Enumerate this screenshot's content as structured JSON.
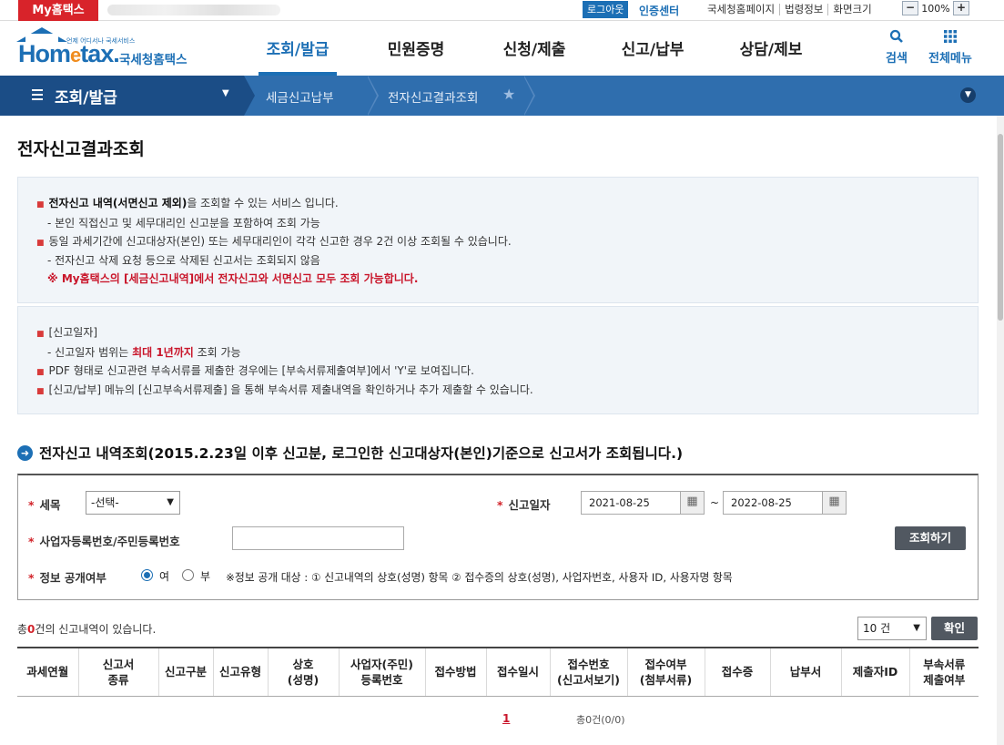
{
  "topbar": {
    "my_tab": "My홈택스",
    "logout": "로그아웃",
    "cert_center": "인증센터",
    "links": [
      "국세청홈페이지",
      "법령정보",
      "화면크기"
    ],
    "zoom_minus": "−",
    "zoom_value": "100%",
    "zoom_plus": "+"
  },
  "header": {
    "logo_small": "언제 어디서나 국세서비스",
    "logo_word_a": "Hom",
    "logo_word_e": "e",
    "logo_word_b": "tax.",
    "logo_korean": "국세청홈택스",
    "gnb": [
      "조회/발급",
      "민원증명",
      "신청/제출",
      "신고/납부",
      "상담/제보"
    ],
    "active_gnb": "조회/발급",
    "search_label": "검색",
    "allmenu_label": "전체메뉴"
  },
  "location": {
    "section": "조회/발급",
    "crumbs": [
      "세금신고납부",
      "전자신고결과조회"
    ]
  },
  "page": {
    "title": "전자신고결과조회"
  },
  "info1": {
    "line1_bold": "전자신고 내역(서면신고 제외)",
    "line1_rest": "을 조회할 수 있는 서비스 입니다.",
    "line2": "- 본인 직접신고 및 세무대리인 신고분을 포함하여 조회 가능",
    "line3": "동일 과세기간에 신고대상자(본인) 또는 세무대리인이 각각 신고한 경우 2건 이상 조회될 수 있습니다.",
    "line4": "- 전자신고 삭제 요청 등으로 삭제된 신고서는 조회되지 않음",
    "line5": "※ My홈택스의 [세금신고내역]에서 전자신고와 서면신고 모두 조회 가능합니다."
  },
  "info2": {
    "line1": "[신고일자]",
    "line2_a": "- 신고일자 범위는 ",
    "line2_red": "최대 1년까지",
    "line2_b": " 조회 가능",
    "line3": "PDF 형태로 신고관련 부속서류를 제출한 경우에는 [부속서류제출여부]에서 'Y'로 보여집니다.",
    "line4": "[신고/납부] 메뉴의 [신고부속서류제출] 을 통해 부속서류 제출내역을 확인하거나 추가 제출할 수 있습니다."
  },
  "search": {
    "section_title": "전자신고 내역조회(2015.2.23일 이후 신고분, 로그인한  신고대상자(본인)기준으로  신고서가 조회됩니다.)",
    "tax_label": "세목",
    "tax_value": "-선택-",
    "date_label": "신고일자",
    "date_from": "2021-08-25",
    "date_to": "2022-08-25",
    "tilde": "~",
    "bizno_label": "사업자등록번호/주민등록번호",
    "bizno_value": "",
    "search_button": "조회하기",
    "disclose_label": "정보 공개여부",
    "radio_yes": "여",
    "radio_no": "부",
    "disclose_selected": "여",
    "disclose_note": "※정보 공개 대상 : ① 신고내역의 상호(성명) 항목 ② 접수증의 상호(성명), 사업자번호, 사용자 ID, 사용자명 항목"
  },
  "results": {
    "total_prefix": "총",
    "total_count": "0",
    "total_suffix": "건의 신고내역이 있습니다.",
    "page_size": "10 건",
    "confirm_button": "확인",
    "columns": [
      [
        "과세연월"
      ],
      [
        "신고서",
        "종류"
      ],
      [
        "신고구분"
      ],
      [
        "신고유형"
      ],
      [
        "상호",
        "(성명)"
      ],
      [
        "사업자(주민)",
        "등록번호"
      ],
      [
        "접수방법"
      ],
      [
        "접수일시"
      ],
      [
        "접수번호",
        "(신고서보기)"
      ],
      [
        "접수여부",
        "(첨부서류)"
      ],
      [
        "접수증"
      ],
      [
        "납부서"
      ],
      [
        "제출자ID"
      ],
      [
        "부속서류",
        "제출여부"
      ]
    ],
    "pager_current": "1",
    "pager_summary": "총0건(0/0)"
  },
  "colors": {
    "brand_blue": "#1c6fb5",
    "nav_dark": "#1b4d86",
    "nav_bar": "#2f6eae",
    "alert_red": "#c9162b"
  }
}
